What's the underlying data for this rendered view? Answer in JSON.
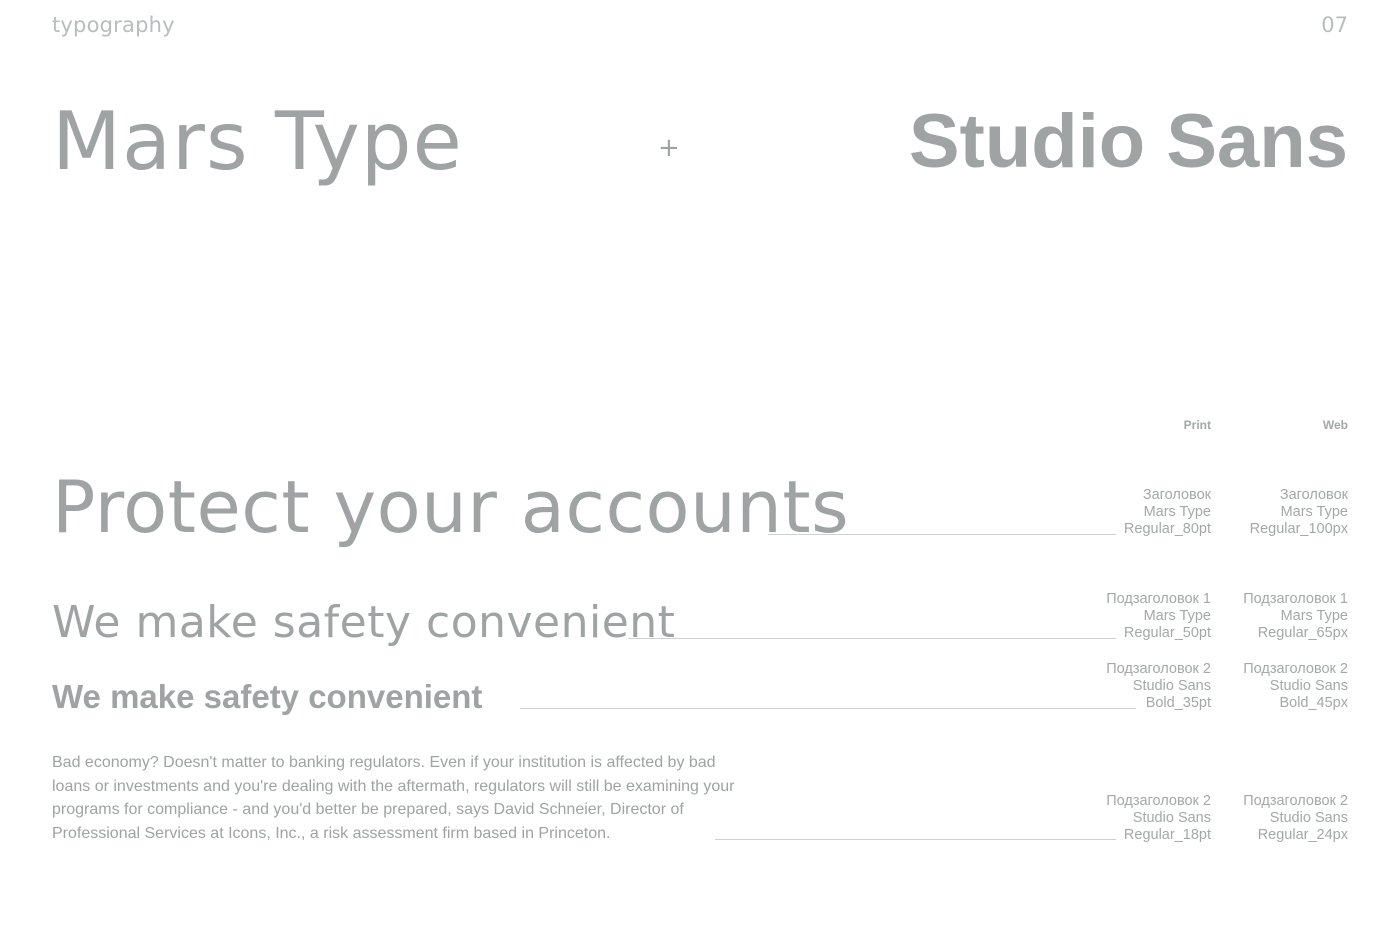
{
  "header": {
    "section_label": "typography",
    "page_number": "07"
  },
  "fonts": {
    "primary": "Mars Type",
    "separator": "+",
    "secondary": "Studio Sans"
  },
  "columns": {
    "print": "Print",
    "web": "Web"
  },
  "samples": [
    {
      "text": "Protect your accounts",
      "print": [
        "Заголовок",
        "Mars Type",
        "Regular_80pt"
      ],
      "web": [
        "Заголовок",
        "Mars Type",
        "Regular_100px"
      ]
    },
    {
      "text": "We make safety convenient",
      "print": [
        "Подзаголовок 1",
        "Mars Type",
        "Regular_50pt"
      ],
      "web": [
        "Подзаголовок 1",
        "Mars Type",
        "Regular_65px"
      ]
    },
    {
      "text": "We make safety convenient",
      "print": [
        "Подзаголовок 2",
        "Studio Sans",
        "Bold_35pt"
      ],
      "web": [
        "Подзаголовок 2",
        "Studio Sans",
        "Bold_45px"
      ]
    },
    {
      "text": "Bad economy? Doesn't matter to banking regulators. Even if your institution is affected by bad loans or investments and you're dealing with the aftermath, regulators will still be examining your programs for compliance - and you'd better be prepared, says David Schneier, Director of Professional Services at Icons, Inc., a risk assessment firm based in Princeton.",
      "print": [
        "Подзаголовок 2",
        "Studio Sans",
        "Regular_18pt"
      ],
      "web": [
        "Подзаголовок 2",
        "Studio Sans",
        "Regular_24px"
      ]
    }
  ],
  "colors": {
    "text": "#9fa3a3",
    "muted": "#b9bdbd",
    "rule": "#cfd2d2",
    "background": "#ffffff"
  }
}
